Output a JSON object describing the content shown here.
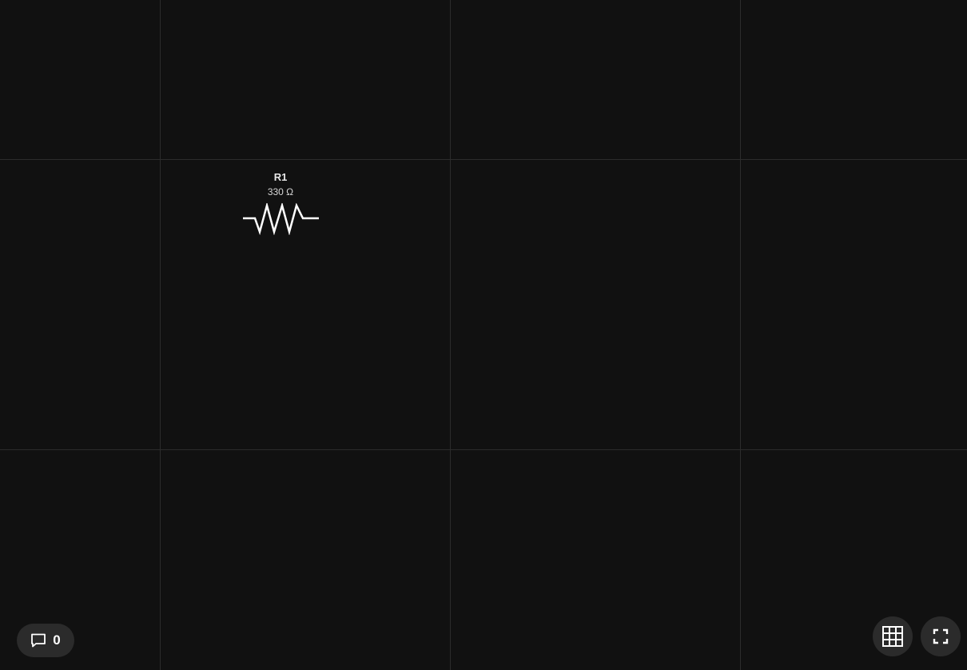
{
  "component": {
    "reference": "R1",
    "value": "330 Ω",
    "type_icon": "resistor-symbol"
  },
  "comments": {
    "count": "0",
    "icon": "comment-icon"
  },
  "controls": {
    "grid_icon": "grid-icon",
    "fullscreen_icon": "fullscreen-icon"
  },
  "colors": {
    "background": "#111111",
    "grid_line": "#2c2c2c",
    "button_bg": "#2b2b2b",
    "symbol": "#ffffff"
  }
}
